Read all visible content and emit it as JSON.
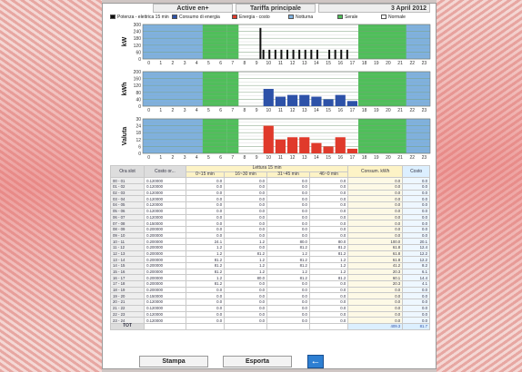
{
  "header": {
    "active": "Active en+",
    "tariff": "Tariffa principale",
    "date": "3 April 2012"
  },
  "legend": [
    {
      "label": "Potenza - elettrica 15 min",
      "color": "#111111"
    },
    {
      "label": "Consumo di energia",
      "color": "#2d52a8"
    },
    {
      "label": "Energia - costo",
      "color": "#e03a2b"
    },
    {
      "label": "Notturna",
      "color": "#7fb1df"
    },
    {
      "label": "Serale",
      "color": "#4fbf5a"
    },
    {
      "label": "Normale",
      "color": "#ffffff"
    }
  ],
  "chart_data": [
    {
      "type": "bar",
      "ylabel": "kW",
      "yticks": [
        "300",
        "240",
        "180",
        "120",
        "60",
        "0"
      ],
      "ylim": [
        0,
        300
      ],
      "categories": [
        "0",
        "1",
        "2",
        "3",
        "4",
        "5",
        "6",
        "7",
        "8",
        "9",
        "10",
        "11",
        "12",
        "13",
        "14",
        "15",
        "16",
        "17",
        "18",
        "19",
        "20",
        "21",
        "22",
        "23"
      ],
      "bars": [
        {
          "h": 9.75,
          "v": 270
        },
        {
          "h": 10.0,
          "v": 80
        },
        {
          "h": 10.5,
          "v": 80
        },
        {
          "h": 11.0,
          "v": 80
        },
        {
          "h": 11.5,
          "v": 80
        },
        {
          "h": 12.0,
          "v": 80
        },
        {
          "h": 12.5,
          "v": 80
        },
        {
          "h": 13.0,
          "v": 80
        },
        {
          "h": 13.5,
          "v": 80
        },
        {
          "h": 14.0,
          "v": 80
        },
        {
          "h": 14.5,
          "v": 80
        },
        {
          "h": 15.5,
          "v": 80
        },
        {
          "h": 16.0,
          "v": 80
        },
        {
          "h": 16.5,
          "v": 80
        },
        {
          "h": 17.0,
          "v": 80
        }
      ]
    },
    {
      "type": "bar",
      "ylabel": "kWh",
      "yticks": [
        "200",
        "160",
        "120",
        "80",
        "40",
        "0"
      ],
      "ylim": [
        0,
        200
      ],
      "categories": [
        "0",
        "1",
        "2",
        "3",
        "4",
        "5",
        "6",
        "7",
        "8",
        "9",
        "10",
        "11",
        "12",
        "13",
        "14",
        "15",
        "16",
        "17",
        "18",
        "19",
        "20",
        "21",
        "22",
        "23"
      ],
      "bars": [
        {
          "h": 10,
          "v": 100
        },
        {
          "h": 11,
          "v": 55
        },
        {
          "h": 12,
          "v": 65
        },
        {
          "h": 13,
          "v": 65
        },
        {
          "h": 14,
          "v": 55
        },
        {
          "h": 15,
          "v": 40
        },
        {
          "h": 16,
          "v": 65
        },
        {
          "h": 17,
          "v": 30
        }
      ]
    },
    {
      "type": "bar",
      "ylabel": "Valuta",
      "yticks": [
        "30",
        "24",
        "18",
        "12",
        "6",
        "0"
      ],
      "ylim": [
        0,
        30
      ],
      "categories": [
        "0",
        "1",
        "2",
        "3",
        "4",
        "5",
        "6",
        "7",
        "8",
        "9",
        "10",
        "11",
        "12",
        "13",
        "14",
        "15",
        "16",
        "17",
        "18",
        "19",
        "20",
        "21",
        "22",
        "23"
      ],
      "bars": [
        {
          "h": 10,
          "v": 24
        },
        {
          "h": 11,
          "v": 12
        },
        {
          "h": 12,
          "v": 14
        },
        {
          "h": 13,
          "v": 14
        },
        {
          "h": 14,
          "v": 9
        },
        {
          "h": 15,
          "v": 6
        },
        {
          "h": 16,
          "v": 14
        },
        {
          "h": 17,
          "v": 4
        }
      ]
    }
  ],
  "bands": {
    "notturna": [
      [
        0,
        7
      ],
      [
        19,
        24
      ]
    ],
    "serale": [
      [
        7,
        8
      ],
      [
        19,
        20
      ]
    ],
    "normale": [
      [
        8,
        19
      ]
    ]
  },
  "table": {
    "h_ora": "Ora slot",
    "h_costo": "Costo or...",
    "h_lettura": "Lettura 15 min",
    "h_q": [
      "0~15 min",
      "16~30 min",
      "31~45 min",
      "46~0 min"
    ],
    "h_cons": "Consum. kWh",
    "h_cost": "Costo",
    "rows": [
      [
        "00 - 01",
        "0.120000",
        "0.0",
        "0.0",
        "0.0",
        "0.0",
        "0.0",
        "0.0"
      ],
      [
        "01 - 02",
        "0.120000",
        "0.0",
        "0.0",
        "0.0",
        "0.0",
        "0.0",
        "0.0"
      ],
      [
        "02 - 03",
        "0.120000",
        "0.0",
        "0.0",
        "0.0",
        "0.0",
        "0.0",
        "0.0"
      ],
      [
        "03 - 04",
        "0.120000",
        "0.0",
        "0.0",
        "0.0",
        "0.0",
        "0.0",
        "0.0"
      ],
      [
        "04 - 05",
        "0.120000",
        "0.0",
        "0.0",
        "0.0",
        "0.0",
        "0.0",
        "0.0"
      ],
      [
        "05 - 06",
        "0.120000",
        "0.0",
        "0.0",
        "0.0",
        "0.0",
        "0.0",
        "0.0"
      ],
      [
        "06 - 07",
        "0.120000",
        "0.0",
        "0.0",
        "0.0",
        "0.0",
        "0.0",
        "0.0"
      ],
      [
        "07 - 08",
        "0.150000",
        "0.0",
        "0.0",
        "0.0",
        "0.0",
        "0.0",
        "0.0"
      ],
      [
        "08 - 09",
        "0.200000",
        "0.0",
        "0.0",
        "0.0",
        "0.0",
        "0.0",
        "0.0"
      ],
      [
        "09 - 10",
        "0.200000",
        "0.0",
        "0.0",
        "0.0",
        "0.0",
        "0.0",
        "0.0"
      ],
      [
        "10 - 11",
        "0.200000",
        "24.1",
        "1.2",
        "80.0",
        "80.0",
        "100.0",
        "20.1"
      ],
      [
        "11 - 12",
        "0.200000",
        "1.2",
        "0.0",
        "81.2",
        "81.2",
        "61.8",
        "12.4"
      ],
      [
        "12 - 13",
        "0.200000",
        "1.2",
        "81.2",
        "1.2",
        "81.2",
        "61.8",
        "12.2"
      ],
      [
        "13 - 14",
        "0.200000",
        "81.2",
        "1.2",
        "81.2",
        "1.2",
        "61.8",
        "12.2"
      ],
      [
        "14 - 15",
        "0.200000",
        "81.2",
        "1.2",
        "81.2",
        "1.2",
        "41.2",
        "8.2"
      ],
      [
        "15 - 16",
        "0.200000",
        "81.2",
        "1.2",
        "1.2",
        "1.2",
        "20.3",
        "6.1"
      ],
      [
        "16 - 17",
        "0.200000",
        "1.2",
        "80.0",
        "81.2",
        "81.2",
        "60.1",
        "14.4"
      ],
      [
        "17 - 18",
        "0.200000",
        "81.2",
        "0.0",
        "0.0",
        "0.0",
        "20.3",
        "4.1"
      ],
      [
        "18 - 19",
        "0.200000",
        "0.0",
        "0.0",
        "0.0",
        "0.0",
        "0.0",
        "0.0"
      ],
      [
        "19 - 20",
        "0.150000",
        "0.0",
        "0.0",
        "0.0",
        "0.0",
        "0.0",
        "0.0"
      ],
      [
        "20 - 21",
        "0.120000",
        "0.0",
        "0.0",
        "0.0",
        "0.0",
        "0.0",
        "0.0"
      ],
      [
        "21 - 22",
        "0.120000",
        "0.0",
        "0.0",
        "0.0",
        "0.0",
        "0.0",
        "0.0"
      ],
      [
        "22 - 23",
        "0.120000",
        "0.0",
        "0.0",
        "0.0",
        "0.0",
        "0.0",
        "0.0"
      ],
      [
        "23 - 24",
        "0.120000",
        "0.0",
        "0.0",
        "0.0",
        "0.0",
        "0.0",
        "0.0"
      ]
    ],
    "tot_label": "TOT",
    "tot_cons": "409.3",
    "tot_cost": "81.7"
  },
  "buttons": {
    "print": "Stampa",
    "export": "Esporta",
    "back_icon": "back-arrow-icon"
  }
}
